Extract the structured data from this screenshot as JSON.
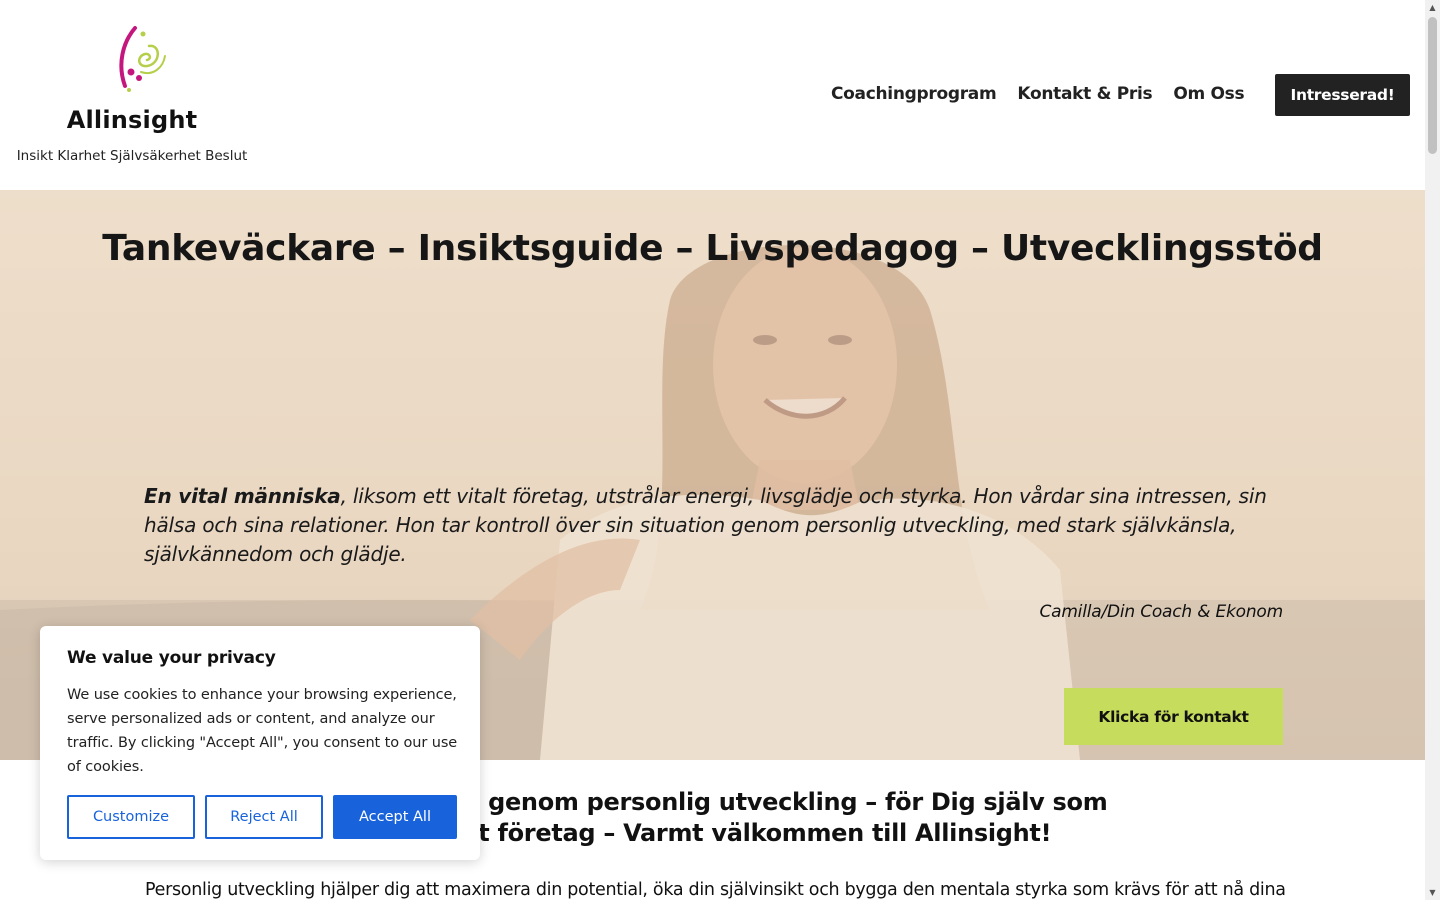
{
  "header": {
    "site_title": "Allinsight",
    "tagline": "Insikt Klarhet Självsäkerhet Beslut",
    "nav": [
      "Coachingprogram",
      "Kontakt & Pris",
      "Om Oss"
    ],
    "cta": "Intresserad!"
  },
  "hero": {
    "title": "Tankeväckare – Insiktsguide – Livspedagog – Utvecklingsstöd",
    "quote_bold": "En vital människa",
    "quote_rest": ", liksom ett vitalt företag, utstrålar energi, livsglädje och styrka. Hon vårdar sina intressen, sin hälsa och sina relationer. Hon tar kontroll över sin situation genom personlig utveckling, med stark självkänsla, självkännedom och glädje.",
    "signature": "Camilla/Din Coach & Ekonom",
    "cta": "Klicka för kontakt"
  },
  "section": {
    "heading_line1": "och vitalitet genom personlig utveckling – för Dig själv som",
    "heading_line2": "r för ditt företag – Varmt välkommen till Allinsight!",
    "body": "Personlig utveckling hjälper dig att maximera din potential, öka din självinsikt och bygga den mentala styrka som krävs för att nå dina"
  },
  "cookie": {
    "title": "We value your privacy",
    "text": "We use cookies to enhance your browsing experience, serve personalized ads or content, and analyze our traffic. By clicking \"Accept All\", you consent to our use of cookies.",
    "customize": "Customize",
    "reject": "Reject All",
    "accept": "Accept All"
  },
  "colors": {
    "accent_green": "#c6dc5c",
    "dark_button": "#222222",
    "cookie_blue": "#1863dc",
    "logo_magenta": "#c4177e",
    "logo_lime": "#b5cf4a"
  }
}
